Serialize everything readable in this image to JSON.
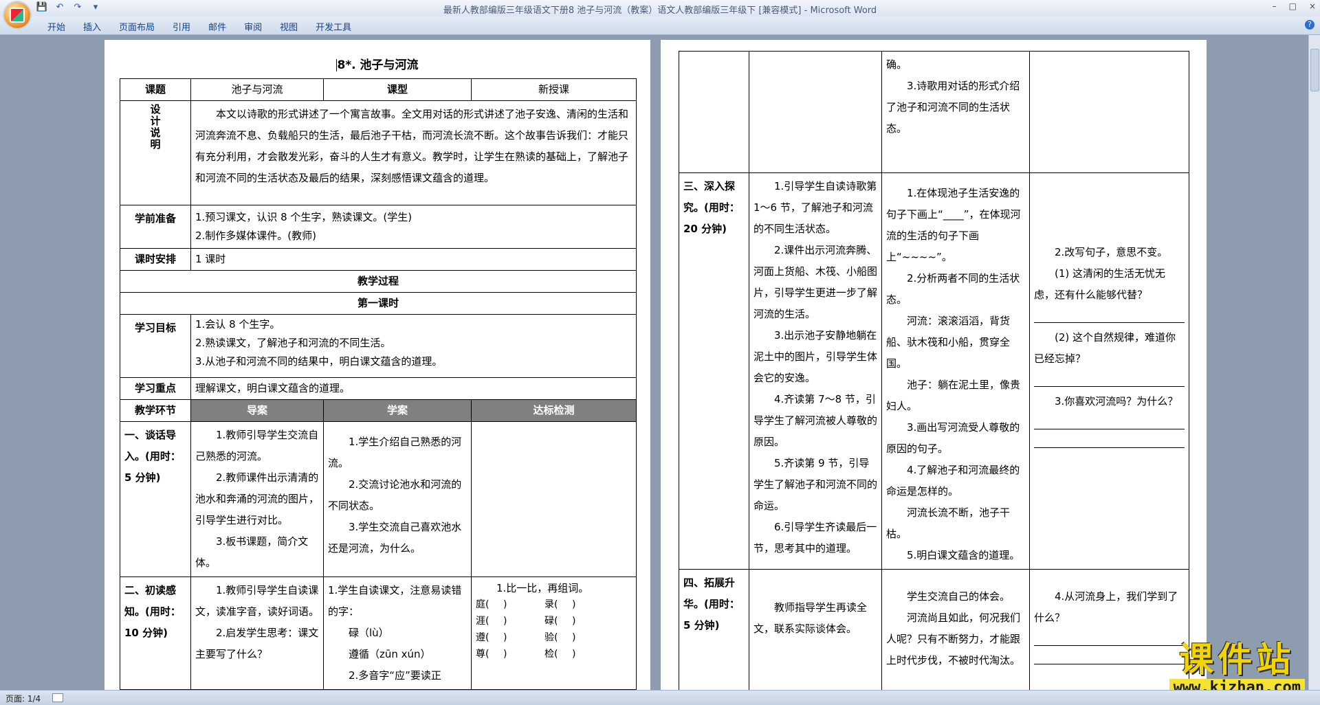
{
  "window": {
    "title": "最新人教部编版三年级语文下册8 池子与河流（教案）语文人教部编版三年级下 [兼容模式] - Microsoft Word",
    "controls": [
      "–",
      "□",
      "×"
    ]
  },
  "quick_access": {
    "icons": [
      "save-icon",
      "undo-icon",
      "redo-icon",
      "customize-icon"
    ],
    "glyphs": [
      "💾",
      "↶",
      "↷",
      "▾"
    ]
  },
  "ribbon": {
    "tabs": [
      "开始",
      "插入",
      "页面布局",
      "引用",
      "邮件",
      "审阅",
      "视图",
      "开发工具"
    ],
    "help": "?"
  },
  "status_bar": {
    "page_info": "页面: 1/4"
  },
  "left_page": {
    "title": "8*. 池子与河流",
    "header_row": {
      "label_lesson": "课题",
      "lesson": "池子与河流",
      "label_type": "课型",
      "type": "新授课"
    },
    "design": {
      "label": "设计说明",
      "text": "本文以诗歌的形式讲述了一个寓言故事。全文用对话的形式讲述了池子安逸、清闲的生活和河流奔流不息、负载船只的生活，最后池子干枯，而河流长流不断。这个故事告诉我们：才能只有充分利用，才会散发光彩，奋斗的人生才有意义。教学时，让学生在熟读的基础上，了解池子和河流不同的生活状态及最后的结果，深刻感悟课文蕴含的道理。"
    },
    "preparation": {
      "label": "学前准备",
      "items": [
        "1.预习课文，认识 8 个生字，熟读课文。(学生)",
        "2.制作多媒体课件。(教师)"
      ]
    },
    "schedule": {
      "label": "课时安排",
      "value": "1 课时"
    },
    "process_label": "教学过程",
    "lesson_label": "第一课时",
    "goals": {
      "label": "学习目标",
      "items": [
        "1.会认 8 个生字。",
        "2.熟读课文，了解池子和河流的不同生活。",
        "3.从池子和河流不同的结果中，明白课文蕴含的道理。"
      ]
    },
    "focus": {
      "label": "学习重点",
      "value": "理解课文，明白课文蕴含的道理。"
    },
    "columns": [
      "教学环节",
      "导案",
      "学案",
      "达标检测"
    ],
    "stage1": {
      "label": "一、谈话导入。(用时：5 分钟)",
      "guide": [
        "1.教师引导学生交流自己熟悉的河流。",
        "2.教师课件出示清清的池水和奔涌的河流的图片，引导学生进行对比。",
        "3.板书课题，简介文体。"
      ],
      "learn": [
        "1.学生介绍自己熟悉的河流。",
        "2.交流讨论池水和河流的不同状态。",
        "3.学生交流自己喜欢池水还是河流，为什么。"
      ]
    },
    "stage2": {
      "label": "二、初读感知。(用时：10 分钟)",
      "guide": [
        "1.教师引导学生自读课文，读准字音，读好词语。",
        "2.启发学生思考：课文主要写了什么？"
      ],
      "learn": [
        "1.学生自读课文，注意易读错的字：",
        "碌（lù）",
        "遵循（zūn xún）",
        "2.多音字“应”要读正"
      ],
      "check_title": "1.比一比，再组词。",
      "check_pairs": [
        [
          "庭(",
          ")",
          "录(",
          ")"
        ],
        [
          "涯(",
          ")",
          "碌(",
          ")"
        ],
        [
          "遵(",
          ")",
          "验(",
          ")"
        ],
        [
          "尊(",
          ")",
          "检(",
          ")"
        ]
      ]
    }
  },
  "right_page": {
    "cont_row": {
      "learn": [
        "确。",
        "3.诗歌用对话的形式介绍了池子和河流不同的生活状态。"
      ]
    },
    "stage3": {
      "label": "三、深入探究。(用时：20 分钟)",
      "guide": [
        "1.引导学生自读诗歌第 1～6 节，了解池子和河流的不同生活状态。",
        "2.课件出示河流奔腾、河面上货船、木筏、小船图片，引导学生更进一步了解河流的生活。",
        "3.出示池子安静地躺在泥土中的图片，引导学生体会它的安逸。",
        "4.齐读第 7～8 节，引导学生了解河流被人尊敬的原因。",
        "5.齐读第 9 节，引导学生了解池子和河流不同的命运。",
        "6.引导学生齐读最后一节，思考其中的道理。"
      ],
      "learn": [
        "1.在体现池子生活安逸的句子下画上“____”，在体现河流的生活的句子下画上“~~~~”。",
        "2.分析两者不同的生活状态。",
        "河流：滚滚滔滔，背货船、驮木筏和小船，贯穿全国。",
        "池子：躺在泥土里，像贵妇人。",
        "3.画出写河流受人尊敬的原因的句子。",
        "4.了解池子和河流最终的命运是怎样的。",
        "河流长流不断，池子干枯。",
        "5.明白课文蕴含的道理。"
      ],
      "check": [
        "2.改写句子，意思不变。",
        "(1) 这清闲的生活无忧无虑，还有什么能够代替？",
        "(2) 这个自然规律，难道你已经忘掉？",
        "3.你喜欢河流吗？为什么？"
      ]
    },
    "stage4": {
      "label": "四、拓展升华。(用时：5 分钟)",
      "guide": [
        "教师指导学生再读全文，联系实际谈体会。"
      ],
      "learn": [
        "学生交流自己的体会。",
        "河流尚且如此，何况我们人呢？只有不断努力，才能跟上时代步伐，不被时代淘汰。"
      ],
      "check": [
        "4.从河流身上，我们学到了什么？"
      ]
    }
  },
  "watermark": {
    "title": "课件站",
    "url": "www.kjzhan.com"
  }
}
